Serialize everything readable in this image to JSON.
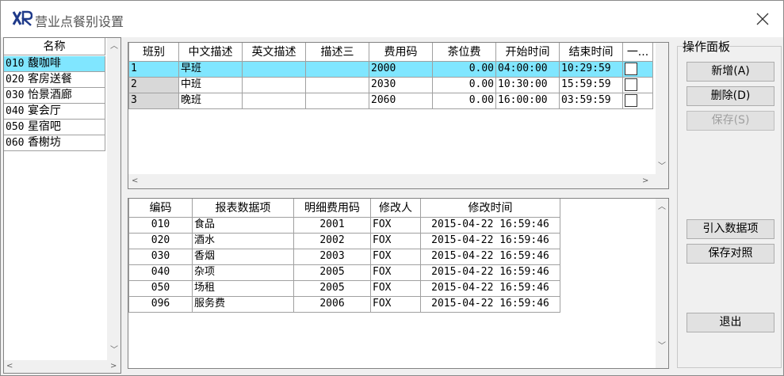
{
  "window": {
    "title": "营业点餐别设置"
  },
  "outlets": {
    "header": "名称",
    "items": [
      {
        "code": "010",
        "name": "馥咖啡",
        "selected": true
      },
      {
        "code": "020",
        "name": "客房送餐",
        "selected": false
      },
      {
        "code": "030",
        "name": "怡景酒廊",
        "selected": false
      },
      {
        "code": "040",
        "name": "宴会厅",
        "selected": false
      },
      {
        "code": "050",
        "name": "星宿吧",
        "selected": false
      },
      {
        "code": "060",
        "name": "香榭坊",
        "selected": false
      }
    ]
  },
  "shifts": {
    "columns": [
      "班别",
      "中文描述",
      "英文描述",
      "描述三",
      "费用码",
      "茶位费",
      "开始时间",
      "结束时间",
      "一..."
    ],
    "rows": [
      {
        "id": "1",
        "cn": "早班",
        "en": "",
        "d3": "",
        "code": "2000",
        "fee": "0.00",
        "start": "04:00:00",
        "end": "10:29:59"
      },
      {
        "id": "2",
        "cn": "中班",
        "en": "",
        "d3": "",
        "code": "2030",
        "fee": "0.00",
        "start": "10:30:00",
        "end": "15:59:59"
      },
      {
        "id": "3",
        "cn": "晚班",
        "en": "",
        "d3": "",
        "code": "2060",
        "fee": "0.00",
        "start": "16:00:00",
        "end": "03:59:59"
      }
    ]
  },
  "report_items": {
    "columns": [
      "编码",
      "报表数据项",
      "明细费用码",
      "修改人",
      "修改时间"
    ],
    "rows": [
      {
        "code": "010",
        "name": "食品",
        "detail": "2001",
        "by": "FOX",
        "time": "2015-04-22 16:59:46"
      },
      {
        "code": "020",
        "name": "酒水",
        "detail": "2002",
        "by": "FOX",
        "time": "2015-04-22 16:59:46"
      },
      {
        "code": "030",
        "name": "香烟",
        "detail": "2003",
        "by": "FOX",
        "time": "2015-04-22 16:59:46"
      },
      {
        "code": "040",
        "name": "杂项",
        "detail": "2005",
        "by": "FOX",
        "time": "2015-04-22 16:59:46"
      },
      {
        "code": "050",
        "name": "场租",
        "detail": "2005",
        "by": "FOX",
        "time": "2015-04-22 16:59:46"
      },
      {
        "code": "096",
        "name": "服务费",
        "detail": "2006",
        "by": "FOX",
        "time": "2015-04-22 16:59:46"
      }
    ]
  },
  "ops": {
    "label": "操作面板",
    "add": "新增(A)",
    "delete": "删除(D)",
    "save": "保存(S)",
    "import": "引入数据项",
    "save_map": "保存对照",
    "exit": "退出"
  },
  "colors": {
    "selected_row": "#80e6ff",
    "row_number_bg": "#d8d8d8"
  }
}
